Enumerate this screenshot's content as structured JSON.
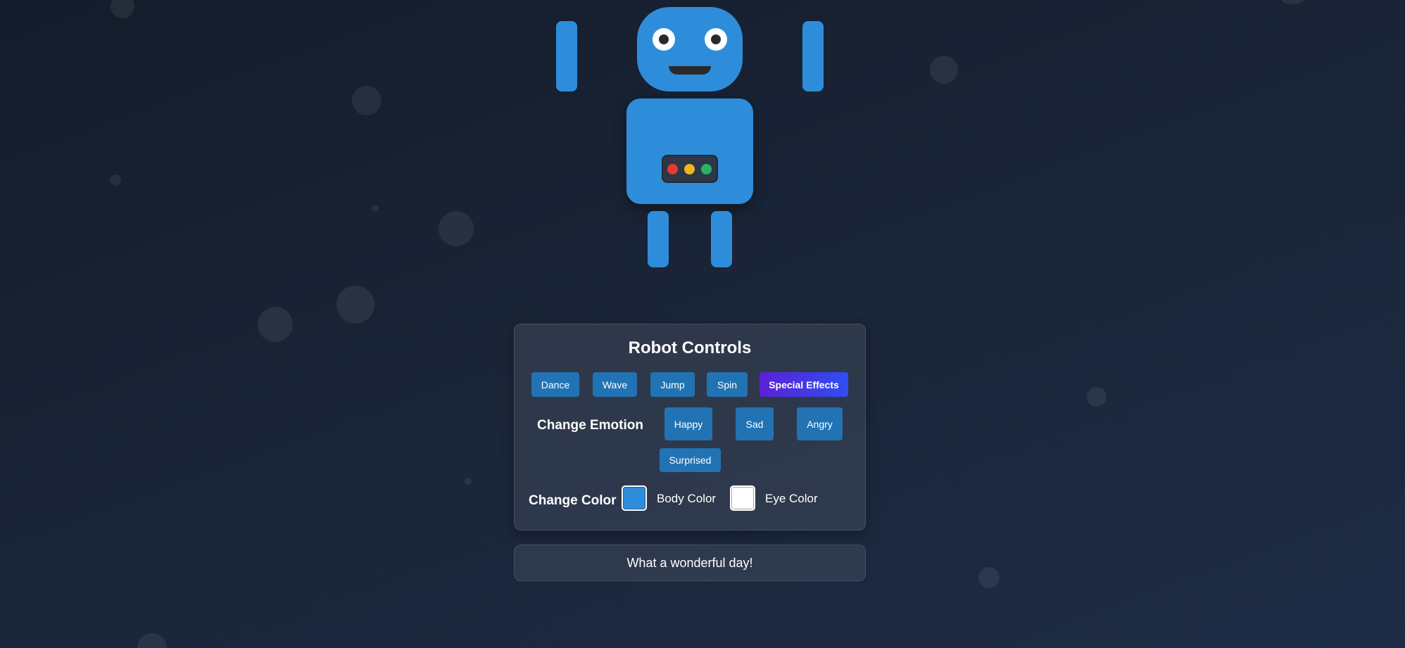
{
  "robot": {
    "body_color": "#2e8ddb",
    "eye_color": "#ffffff",
    "chest_lights": [
      "#e53b2e",
      "#f2b619",
      "#27b565"
    ]
  },
  "controls": {
    "title": "Robot Controls",
    "actions": {
      "dance": "Dance",
      "wave": "Wave",
      "jump": "Jump",
      "spin": "Spin",
      "special": "Special Effects"
    },
    "emotion": {
      "label": "Change Emotion",
      "happy": "Happy",
      "sad": "Sad",
      "angry": "Angry",
      "surprised": "Surprised"
    },
    "color": {
      "label": "Change Color",
      "body_label": "Body Color",
      "eye_label": "Eye Color"
    }
  },
  "message": "What a wonderful day!",
  "colors": {
    "button": "#2173b4",
    "special_gradient": [
      "#5b21d6",
      "#2f4df2"
    ]
  }
}
